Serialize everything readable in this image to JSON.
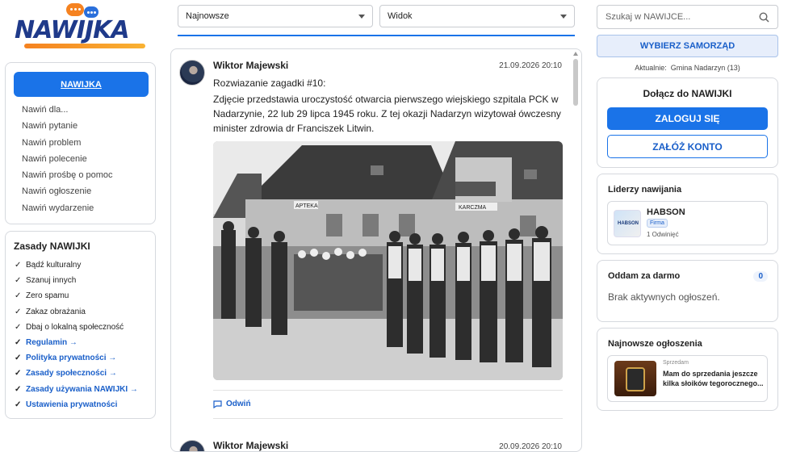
{
  "logo": {
    "text": "NAWIJKA"
  },
  "nav": {
    "primary": "NAWIJKA",
    "items": [
      "Nawiń dla...",
      "Nawiń pytanie",
      "Nawiń problem",
      "Nawiń polecenie",
      "Nawiń prośbę o pomoc",
      "Nawiń ogłoszenie",
      "Nawiń wydarzenie"
    ]
  },
  "rules": {
    "title": "Zasady NAWIJKI",
    "items": [
      "Bądź kulturalny",
      "Szanuj innych",
      "Zero spamu",
      "Zakaz obrażania",
      "Dbaj o lokalną społeczność"
    ],
    "links": [
      "Regulamin →",
      "Polityka prywatności →",
      "Zasady społeczności →",
      "Zasady używania NAWIJKI →",
      "Ustawienia prywatności"
    ]
  },
  "filters": {
    "sort": "Najnowsze",
    "view": "Widok"
  },
  "post": {
    "author": "Wiktor Majewski",
    "date": "21.09.2026 20:10",
    "title": "Rozwiazanie zagadki #10:",
    "body": "Zdjęcie przedstawia uroczystość otwarcia pierwszego wiejskiego szpitala PCK w Nadarzynie, 22 lub 29 lipca 1945 roku. Z tej okazji Nadarzyn wizytował ówczesny minister zdrowia dr Franciszek Litwin.",
    "photo_signs": [
      "APTEKA",
      "KARCZMA"
    ],
    "reply": "Odwiń"
  },
  "post2": {
    "author": "Wiktor Majewski",
    "date": "20.09.2026 20:10"
  },
  "right": {
    "search_placeholder": "Szukaj w NAWIJCE...",
    "choose": "WYBIERZ SAMORZĄD",
    "current_label": "Aktualnie:",
    "current_value": "Gmina Nadarzyn (13)",
    "join_title": "Dołącz do NAWIJKI",
    "login": "ZALOGUJ SIĘ",
    "register": "ZAŁÓŻ KONTO",
    "leaders_title": "Liderzy nawijania",
    "leader": {
      "name": "HABSON",
      "badge": "Firma",
      "count": "1 Odwinięć",
      "logo_text": "HABSON"
    },
    "free_title": "Oddam za darmo",
    "free_count": "0",
    "free_empty": "Brak aktywnych ogłoszeń.",
    "ads_title": "Najnowsze ogłoszenia",
    "ad": {
      "category": "Sprzedam",
      "text": "Mam do sprzedania jeszcze kilka słoików tegorocznego..."
    }
  },
  "colors": {
    "accent": "#1a73e8",
    "link": "#1a5fc9",
    "logo_orange": "#f58220",
    "logo_blue": "#1f3a8a"
  }
}
